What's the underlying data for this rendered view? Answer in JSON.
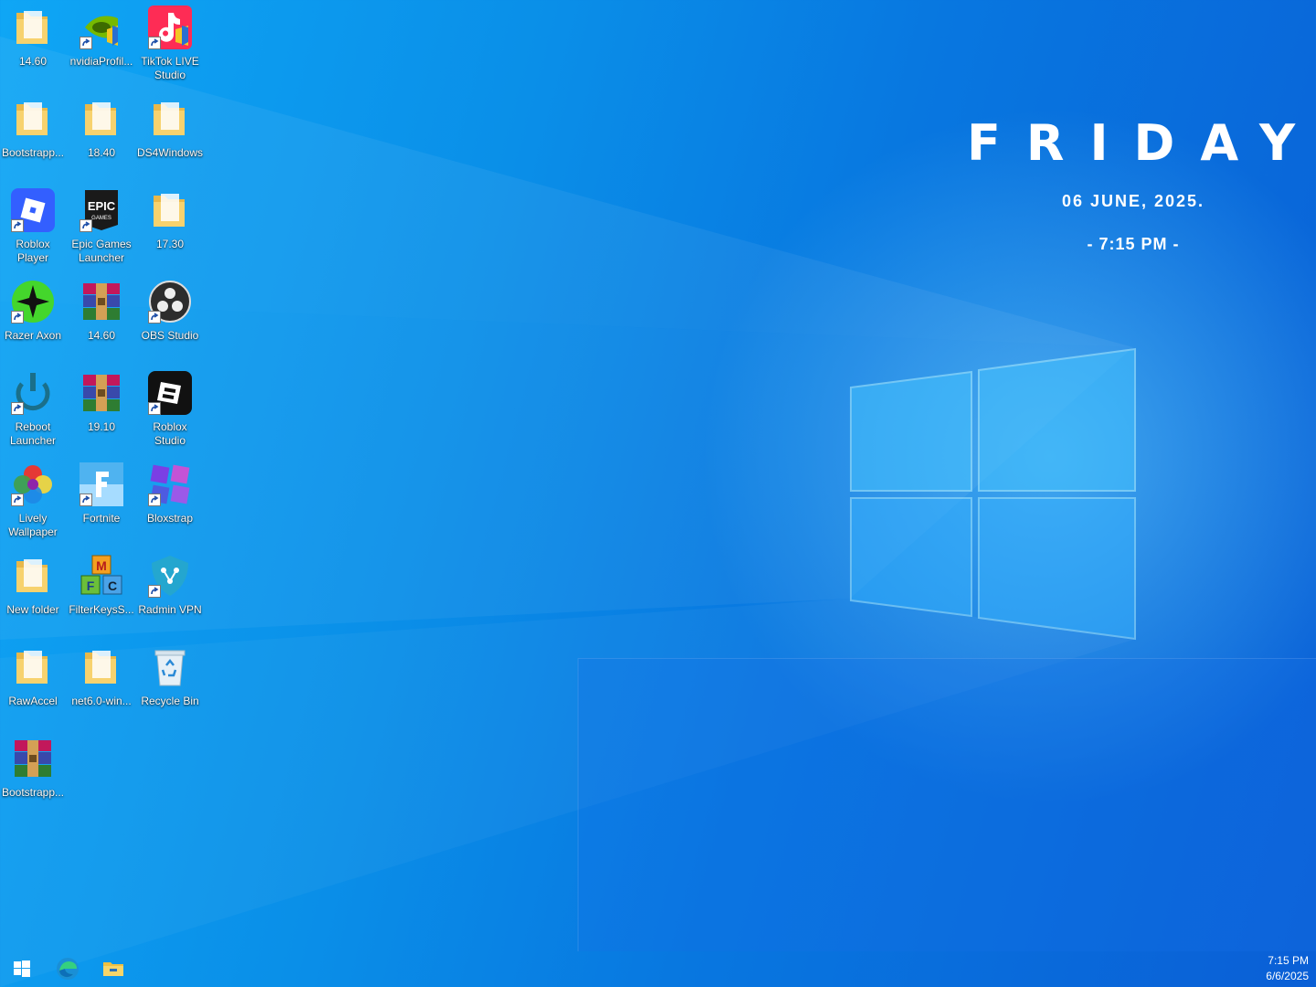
{
  "desktop": {
    "icons": [
      {
        "label": "14.60",
        "icon": "folder-icon"
      },
      {
        "label": "nvidiaProfil...",
        "icon": "nvidia-icon"
      },
      {
        "label": "TikTok LIVE\nStudio",
        "icon": "tiktok-icon"
      },
      {
        "label": "Bootstrapp...",
        "icon": "folder-icon"
      },
      {
        "label": "18.40",
        "icon": "folder-icon"
      },
      {
        "label": "DS4Windows",
        "icon": "folder-icon"
      },
      {
        "label": "Roblox\nPlayer",
        "icon": "roblox-player-icon"
      },
      {
        "label": "Epic Games\nLauncher",
        "icon": "epic-games-icon"
      },
      {
        "label": "17.30",
        "icon": "folder-icon"
      },
      {
        "label": "Razer Axon",
        "icon": "razer-axon-icon"
      },
      {
        "label": "14.60",
        "icon": "winrar-archive-icon"
      },
      {
        "label": "OBS Studio",
        "icon": "obs-icon"
      },
      {
        "label": "Reboot\nLauncher",
        "icon": "reboot-launcher-icon"
      },
      {
        "label": "19.10",
        "icon": "winrar-archive-icon"
      },
      {
        "label": "Roblox\nStudio",
        "icon": "roblox-studio-icon"
      },
      {
        "label": "Lively\nWallpaper",
        "icon": "lively-wallpaper-icon"
      },
      {
        "label": "Fortnite",
        "icon": "fortnite-icon"
      },
      {
        "label": "Bloxstrap",
        "icon": "bloxstrap-icon"
      },
      {
        "label": "New folder",
        "icon": "folder-icon"
      },
      {
        "label": "FilterKeysS...",
        "icon": "filterkeys-icon"
      },
      {
        "label": "Radmin VPN",
        "icon": "radmin-vpn-icon"
      },
      {
        "label": "RawAccel",
        "icon": "folder-icon"
      },
      {
        "label": "net6.0-win...",
        "icon": "folder-icon"
      },
      {
        "label": "Recycle Bin",
        "icon": "recycle-bin-icon"
      },
      {
        "label": "Bootstrapp...",
        "icon": "winrar-archive-icon"
      }
    ]
  },
  "widget": {
    "day": "FRIDAY",
    "date": "06 JUNE, 2025.",
    "time": "- 7:15 PM -"
  },
  "taskbar": {
    "buttons": [
      {
        "name": "start-button",
        "icon": "windows-logo-icon"
      },
      {
        "name": "edge-button",
        "icon": "edge-icon"
      },
      {
        "name": "file-explorer-button",
        "icon": "file-explorer-icon"
      }
    ],
    "clock_time": "7:15 PM",
    "clock_date": "6/6/2025"
  },
  "colors": {
    "desktop_bg": "#0a8fe8",
    "accent": "#0078d7"
  }
}
